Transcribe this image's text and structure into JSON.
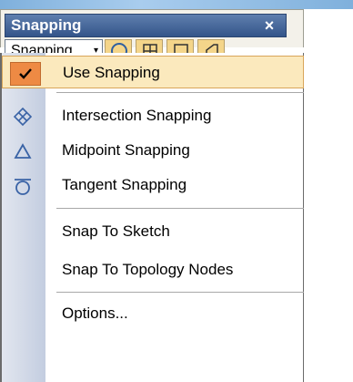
{
  "window": {
    "title": "Snapping",
    "close_glyph": "×"
  },
  "toolbar": {
    "dropdown_label": "Snapping",
    "dropdown_arrow_glyph": "▾",
    "tools": [
      {
        "icon": "circle-icon"
      },
      {
        "icon": "grid-icon"
      },
      {
        "icon": "square-icon"
      },
      {
        "icon": "tangent-shape-icon"
      }
    ]
  },
  "menu": {
    "items": [
      {
        "label": "Use Snapping",
        "checked": true,
        "icon": "check-icon"
      },
      {
        "label": "Intersection Snapping",
        "icon": "intersection-icon"
      },
      {
        "label": "Midpoint Snapping",
        "icon": "triangle-icon"
      },
      {
        "label": "Tangent Snapping",
        "icon": "tangent-icon"
      },
      {
        "label": "Snap To Sketch"
      },
      {
        "label": "Snap To Topology Nodes"
      },
      {
        "label": "Options..."
      }
    ]
  },
  "colors": {
    "title_bar": "#34558a",
    "highlight_bg": "#fbe9bd",
    "check_bg": "#ee8a44",
    "tool_button_bg": "#f4d58a"
  }
}
